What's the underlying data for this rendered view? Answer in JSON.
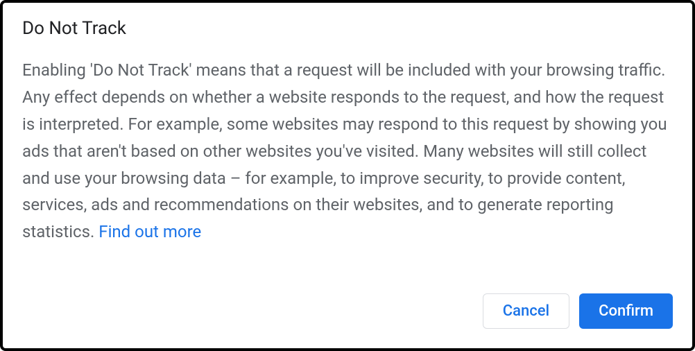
{
  "dialog": {
    "title": "Do Not Track",
    "body_text": "Enabling 'Do Not Track' means that a request will be included with your browsing traffic. Any effect depends on whether a website responds to the request, and how the request is interpreted. For example, some websites may respond to this request by showing you ads that aren't based on other websites you've visited. Many websites will still collect and use your browsing data – for example, to improve security, to provide content, services, ads and recommendations on their websites, and to generate reporting statistics. ",
    "link_text": "Find out more",
    "cancel_label": "Cancel",
    "confirm_label": "Confirm"
  }
}
